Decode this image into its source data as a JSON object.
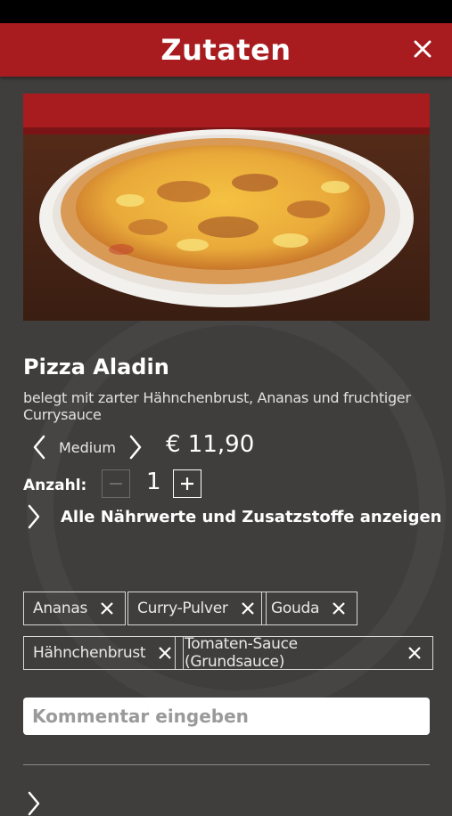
{
  "header": {
    "title": "Zutaten"
  },
  "product": {
    "name": "Pizza Aladin",
    "description": "belegt mit zarter Hähnchenbrust, Ananas und fruchtiger Currysauce",
    "size": "Medium",
    "price": "€ 11,90",
    "quantity_label": "Anzahl:",
    "quantity": "1"
  },
  "nutrition": {
    "label": "Alle Nährwerte und Zusatzstoffe anzeigen"
  },
  "ingredients": [
    {
      "label": "Ananas"
    },
    {
      "label": "Curry-Pulver"
    },
    {
      "label": "Gouda"
    },
    {
      "label": "Hähnchenbrust"
    },
    {
      "label": "Tomaten-Sauce (Grundsauce)"
    }
  ],
  "comment": {
    "placeholder": "Kommentar eingeben"
  },
  "colors": {
    "brand_red": "#a81b1e",
    "background": "#3f3e3d"
  }
}
